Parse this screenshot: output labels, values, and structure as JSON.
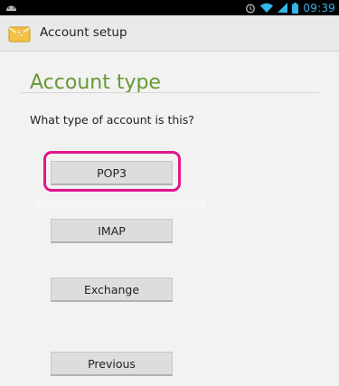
{
  "status_bar": {
    "time": "09:39",
    "icons": [
      "android-icon",
      "alarm-icon",
      "wifi-icon",
      "signal-icon",
      "battery-icon"
    ]
  },
  "app_bar": {
    "title": "Account setup",
    "icon": "email-icon"
  },
  "main": {
    "heading": "Account type",
    "question": "What type of account is this?",
    "buttons": {
      "pop3": "POP3",
      "imap": "IMAP",
      "exchange": "Exchange",
      "previous": "Previous"
    }
  },
  "colors": {
    "heading": "#669933",
    "highlight": "#e0168a",
    "time": "#33b5e5"
  }
}
